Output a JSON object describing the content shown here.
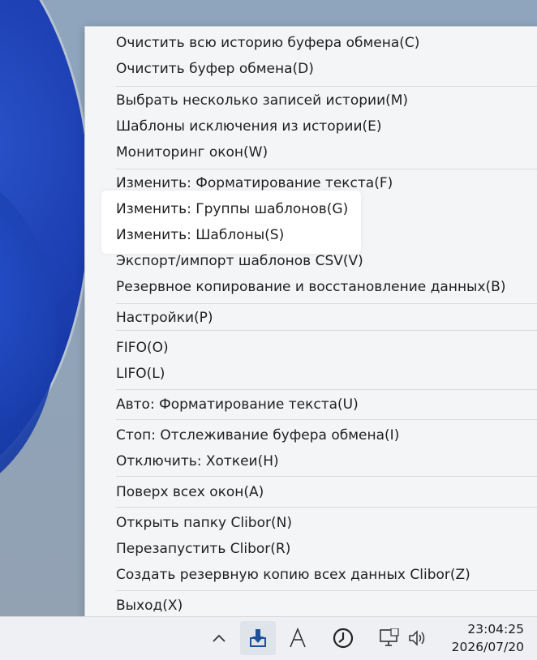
{
  "menu": {
    "items": [
      "Очистить всю историю буфера обмена(C)",
      "Очистить буфер обмена(D)",
      "Выбрать несколько записей истории(M)",
      "Шаблоны исключения из истории(E)",
      "Мониторинг окон(W)",
      "Изменить: Форматирование текста(F)",
      "Изменить: Группы шаблонов(G)",
      "Изменить: Шаблоны(S)",
      "Экспорт/импорт шаблонов CSV(V)",
      "Резервное копирование и восстановление данных(B)",
      "Настройки(P)",
      "FIFO(O)",
      "LIFO(L)",
      "Авто: Форматирование текста(U)",
      "Стоп: Отслеживание буфера обмена(I)",
      "Отключить: Хоткеи(H)",
      "Поверх всех окон(A)",
      "Открыть папку Clibor(N)",
      "Перезапустить Clibor(R)",
      "Создать резервную копию всех данных Clibor(Z)",
      "Выход(X)"
    ]
  },
  "taskbar": {
    "time": "23:04:25",
    "date": "2026/07/20",
    "icons": [
      "chevron-up-icon",
      "clibor-download-icon",
      "font-a-icon",
      "clock-icon",
      "network-icon",
      "speaker-icon"
    ]
  }
}
